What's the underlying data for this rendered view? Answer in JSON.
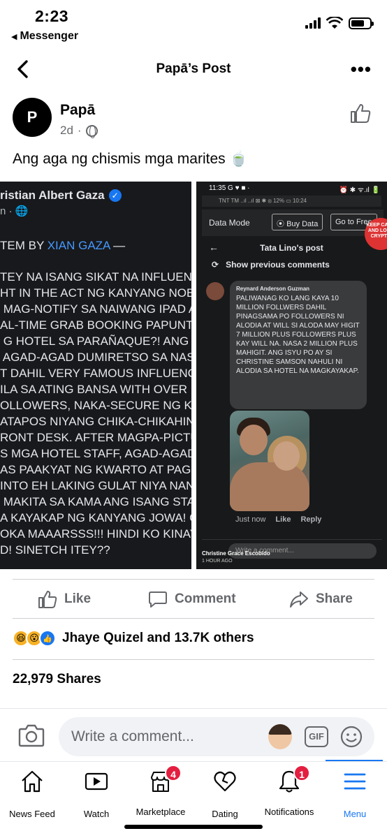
{
  "status_bar": {
    "time": "2:23",
    "back_app": "Messenger"
  },
  "header": {
    "title": "Papā’s Post",
    "more": "•••"
  },
  "post": {
    "author": "Papā",
    "avatar_letter": "P",
    "age": "2d",
    "separator": "·",
    "text": "Ang aga ng chismis mga marites 🍵"
  },
  "image_left": {
    "name": "ristian Albert Gaza",
    "sub": "n ·",
    "item_by_prefix": "TEM BY ",
    "item_by_link": "XIAN GAZA",
    "item_by_suffix": " —",
    "body": "TEY NA ISANG SIKAT NA INFLUENC\nHT IN THE ACT NG KANYANG NOBY\n MAG-NOTIFY SA NAIWANG IPAD A\nAL-TIME GRAB BOOKING PAPUNTA\n G HOTEL SA PARAÑAQUE?! ANG KA\n AGAD-AGAD DUMIRETSO SA NAS\nT DAHIL VERY FAMOUS INFLUENC\nILA SA ATING BANSA WITH OVER 1\nOLLOWERS, NAKA-SECURE NG KEY\nATAPOS NIYANG CHIKA-CHIKAHIN\nRONT DESK. AFTER MAGPA-PICTUR\nS MGA HOTEL STAFF, AGAD-AGAD S\nAS PAAKYAT NG KWARTO AT PAGB\nINTO EH LAKING GULAT NIYA NAN\n MAKITA SA KAMA ANG ISANG STA\nA KAYAKAP NG KANYANG JOWA! C\nOKA MAAARSSS!!! HINDI KO KINAY\nD! SINETCH ITEY??"
  },
  "image_right": {
    "status_time": "11:35 G ♥ ■ ·",
    "status_right": "⏰ ✱ ᯤ.ıl 🔋",
    "substatus": "TNT TM ..ıl ..ıl ⊠   ✱ ⦻ 12% ▭ 10:24",
    "data_mode": "Data Mode",
    "buy_data": "Buy Data",
    "go_free": "Go to Free",
    "keep_calm": "KEEP CALM AND LOVE CRYPTO",
    "post_title": "Tata Lino's post",
    "prev_comments": "Show previous comments",
    "commenter": "Reynard Anderson Guzman",
    "comment": "PALIWANAG KO LANG KAYA 10 MILLION FOLLWERS DAHIL PINAGSAMA PO FOLLOWERS NI ALODIA AT WILL SI ALODA MAY HIGIT 7 MILLION PLUS FOLLOWERS PLUS KAY WILL NA. NASA 2 MILLION PLUS MAHIGIT. ANG ISYU PO AY SI CHRISTINE SAMSON NAHULI NI ALODIA SA HOTEL NA MAGKAYAKAP.",
    "just_now": "Just now",
    "like": "Like",
    "reply": "Reply",
    "write_comment": "Write a comment...",
    "overlay_name": "Christine Grace Escobido",
    "overlay_time": "1 HOUR AGO"
  },
  "actions": {
    "like": "Like",
    "comment": "Comment",
    "share": "Share"
  },
  "reactions": {
    "text": "Jhaye Quizel and 13.7K others"
  },
  "shares": "22,979 Shares",
  "composer": {
    "placeholder": "Write a comment...",
    "gif": "GIF"
  },
  "tabs": [
    {
      "label": "News Feed",
      "icon": "home-icon"
    },
    {
      "label": "Watch",
      "icon": "video-icon"
    },
    {
      "label": "Marketplace",
      "icon": "store-icon",
      "badge": "4"
    },
    {
      "label": "Dating",
      "icon": "heart-icon"
    },
    {
      "label": "Notifications",
      "icon": "bell-icon",
      "badge": "1"
    },
    {
      "label": "Menu",
      "icon": "menu-icon"
    }
  ],
  "colors": {
    "accent": "#1877f2",
    "badge": "#e41e3f",
    "secondary_text": "#65676b"
  }
}
